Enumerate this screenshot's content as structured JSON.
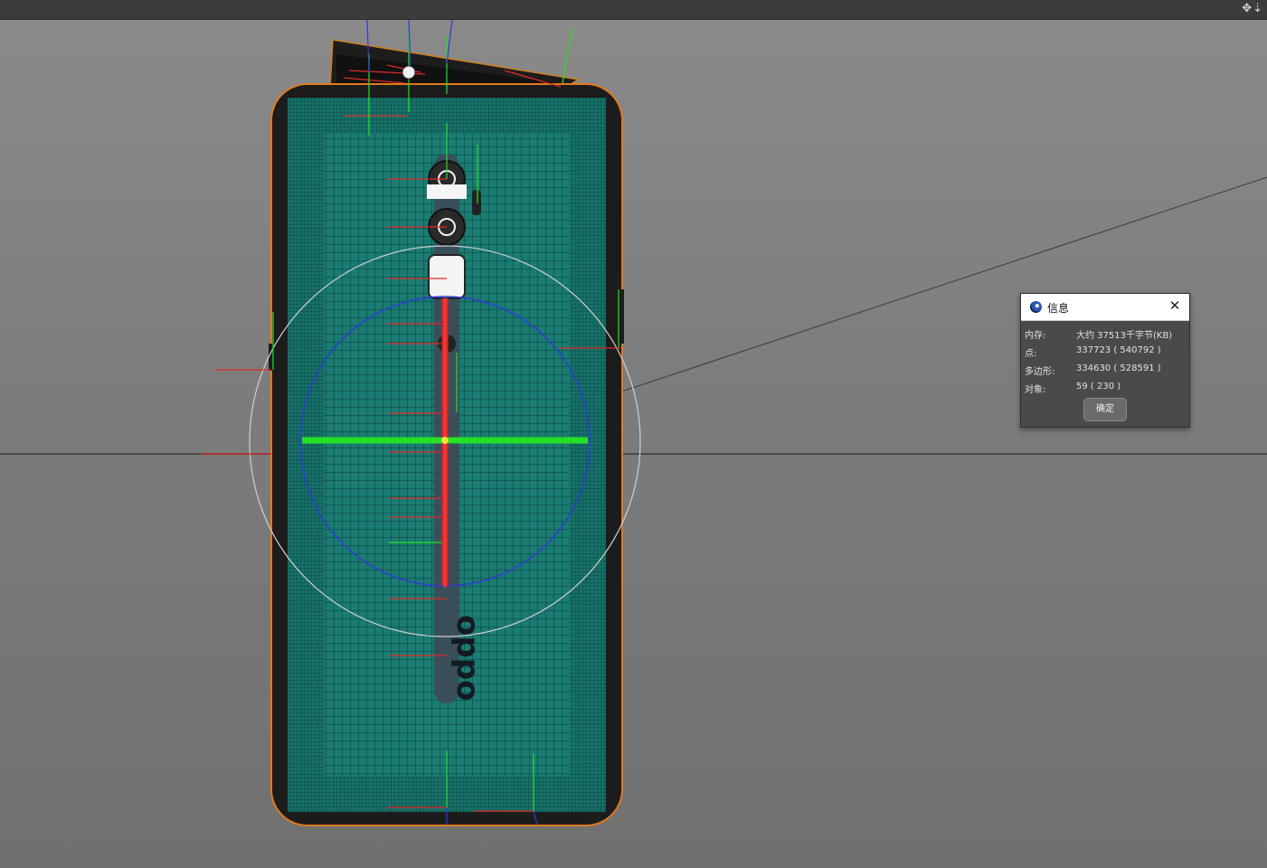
{
  "topbar": {
    "nav_icons": "✥⇣"
  },
  "viewport": {
    "model_name": "phone-back-model",
    "brand_logo_text": "oppo",
    "colors": {
      "mesh": "#1a7c73",
      "shell": "#1c1c1c",
      "selection_outline": "#e07a1f",
      "axis_x": "#e02828",
      "axis_y": "#26e026",
      "axis_z": "#2e3bd6",
      "background": "#7d7d7d"
    }
  },
  "info_dialog": {
    "title": "信息",
    "close_label": "✕",
    "rows": [
      {
        "label": "内存:",
        "value": "大约 37513千字节(KB)"
      },
      {
        "label": "点:",
        "value": "337723 ( 540792 )"
      },
      {
        "label": "多边形:",
        "value": "334630 ( 528591 )"
      },
      {
        "label": "对象:",
        "value": "59 ( 230 )"
      }
    ],
    "ok_label": "确定"
  }
}
